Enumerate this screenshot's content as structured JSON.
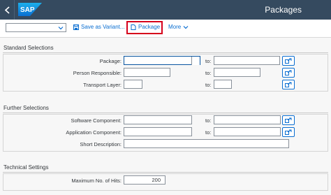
{
  "shell": {
    "logo_text": "SAP",
    "title": "Packages"
  },
  "toolbar": {
    "variant_value": "",
    "save_variant_label": "Save as Variant...",
    "package_label": "Package",
    "more_label": "More"
  },
  "standard": {
    "title": "Standard Selections",
    "package_label": "Package:",
    "person_label": "Person Responsible:",
    "transport_label": "Transport Layer:",
    "to_label": "to:"
  },
  "further": {
    "title": "Further Selections",
    "software_label": "Software Component:",
    "application_label": "Application Component:",
    "short_desc_label": "Short Description:",
    "to_label": "to:"
  },
  "technical": {
    "title": "Technical Settings",
    "max_hits_label": "Maximum No. of Hits:",
    "max_hits_value": "200"
  },
  "colors": {
    "shell_bg": "#354a5f",
    "link": "#0a6ed1",
    "highlight": "#d6001c"
  }
}
